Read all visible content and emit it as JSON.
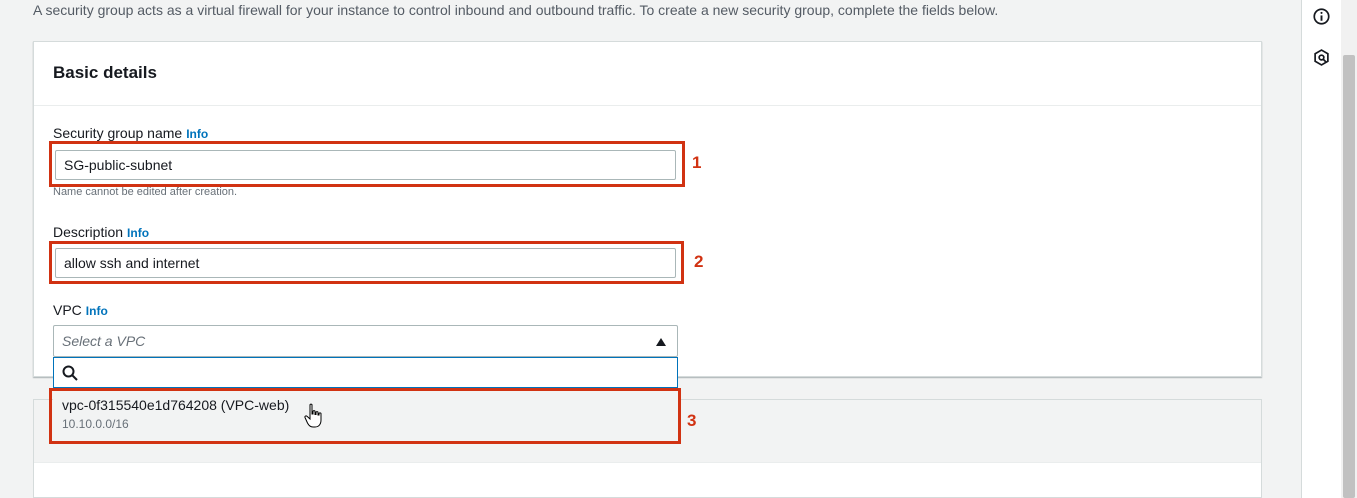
{
  "intro_text": "A security group acts as a virtual firewall for your instance to control inbound and outbound traffic. To create a new security group, complete the fields below.",
  "basic_details": {
    "title": "Basic details",
    "info_link": "Info",
    "name": {
      "label": "Security group name",
      "value": "SG-public-subnet",
      "hint": "Name cannot be edited after creation."
    },
    "description": {
      "label": "Description",
      "value": "allow ssh and internet"
    },
    "vpc": {
      "label": "VPC",
      "placeholder": "Select a VPC",
      "search_value": "",
      "options": [
        {
          "id": "vpc-0f315540e1d764208 (VPC-web)",
          "cidr": "10.10.0.0/16"
        }
      ]
    }
  },
  "annotations": [
    "1",
    "2",
    "3"
  ],
  "colors": {
    "annotation_red": "#d13212",
    "link_blue": "#0073bb",
    "focus_blue": "#0073bb"
  },
  "icons": {
    "rail_info": "info-circle-icon",
    "rail_tutorial": "hexagon-icon",
    "search": "search-icon",
    "caret": "caret-up-icon",
    "cursor": "hand-pointer-icon"
  }
}
